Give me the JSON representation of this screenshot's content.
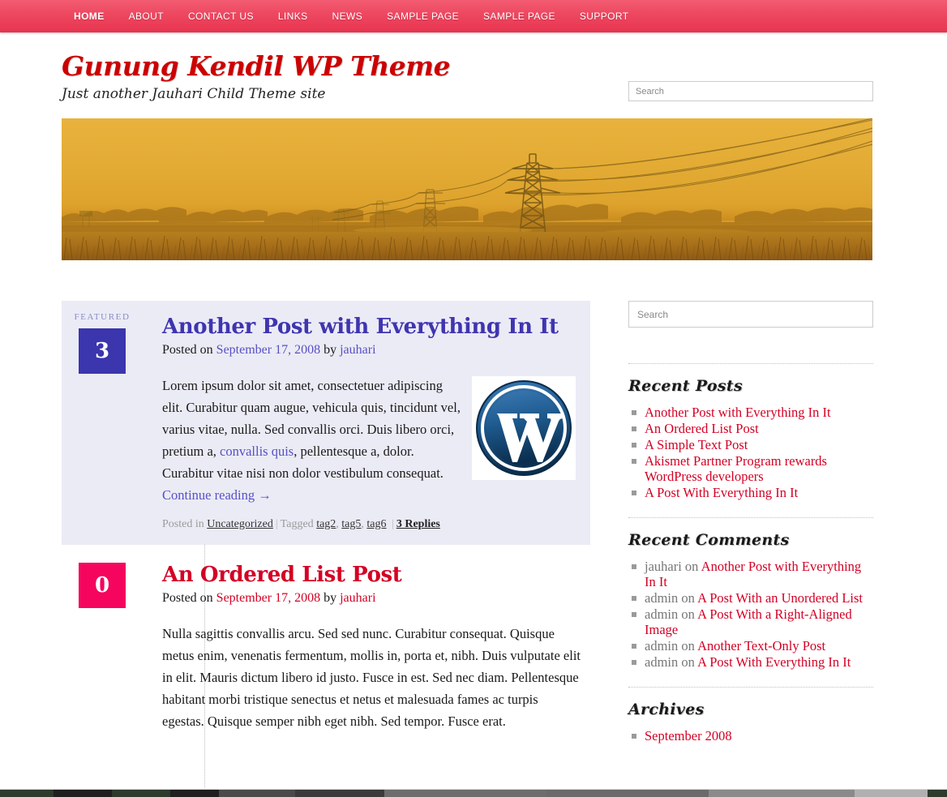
{
  "nav": {
    "items": [
      {
        "label": "HOME",
        "current": true
      },
      {
        "label": "ABOUT",
        "current": false
      },
      {
        "label": "CONTACT US",
        "current": false
      },
      {
        "label": "LINKS",
        "current": false
      },
      {
        "label": "NEWS",
        "current": false
      },
      {
        "label": "SAMPLE PAGE",
        "current": false
      },
      {
        "label": "SAMPLE PAGE",
        "current": false
      },
      {
        "label": "SUPPORT",
        "current": false
      }
    ]
  },
  "header": {
    "site_title": "Gunung Kendil WP Theme",
    "site_description": "Just another Jauhari Child Theme site",
    "search_placeholder": "Search",
    "search_value": "",
    "banner_alt": "sunset-field-powerlines-banner"
  },
  "colors": {
    "nav_red": "#e8344f",
    "title_red": "#cc0000",
    "featured_bg": "#ebebf6",
    "date_blue": "#3b35ae",
    "date_pink": "#f5055e",
    "link_violet": "#5750c4",
    "link_red": "#d40024"
  },
  "posts": [
    {
      "featured": true,
      "featured_label": "FEATURED",
      "comment_count": "3",
      "box_color": "blue",
      "title": "Another Post with Everything In It",
      "title_color": "violet",
      "posted_on_prefix": "Posted on ",
      "date": "September 17, 2008",
      "by_text": " by ",
      "author": "jauhari",
      "body_part_1": "Lorem ipsum dolor sit amet, consectetuer adipiscing elit. Curabitur quam augue, vehicula quis, tincidunt vel, varius vitae, nulla. Sed convallis orci. Duis libero orci, pretium a, ",
      "body_link": "convallis quis",
      "body_part_2": ", pellentesque a, dolor. Curabitur vitae nisi non dolor vestibulum consequat. ",
      "more_link": "Continue reading →",
      "has_image": true,
      "image_name": "wordpress-logo",
      "footer": {
        "posted_in_label": "Posted in ",
        "category": "Uncategorized",
        "tagged_label": "Tagged ",
        "tags": [
          "tag2",
          "tag5",
          "tag6"
        ],
        "replies": "3 Replies"
      }
    },
    {
      "featured": false,
      "featured_label": "",
      "comment_count": "0",
      "box_color": "pink",
      "title": "An Ordered List Post",
      "title_color": "red",
      "posted_on_prefix": "Posted on ",
      "date": "September 17, 2008",
      "by_text": " by ",
      "author": "jauhari",
      "body_part_1": "Nulla sagittis convallis arcu. Sed sed nunc. Curabitur consequat. Quisque metus enim, venenatis fermentum, mollis in, porta et, nibh. Duis vulputate elit in elit. Mauris dictum libero id justo. Fusce in est. Sed nec diam. Pellentesque habitant morbi tristique senectus et netus et malesuada fames ac turpis egestas. Quisque semper nibh eget nibh. Sed tempor. Fusce erat.",
      "body_link": "",
      "body_part_2": "",
      "more_link": "",
      "has_image": false,
      "image_name": "",
      "footer": null
    }
  ],
  "sidebar": {
    "search_placeholder": "Search",
    "search_value": "",
    "widgets": [
      {
        "title": "Recent Posts",
        "type": "links",
        "items": [
          {
            "prefix": "",
            "link": "Another Post with Everything In It"
          },
          {
            "prefix": "",
            "link": "An Ordered List Post"
          },
          {
            "prefix": "",
            "link": "A Simple Text Post"
          },
          {
            "prefix": "",
            "link": "Akismet Partner Program rewards WordPress developers"
          },
          {
            "prefix": "",
            "link": "A Post With Everything In It"
          }
        ]
      },
      {
        "title": "Recent Comments",
        "type": "comments",
        "items": [
          {
            "prefix": "jauhari on ",
            "link": "Another Post with Everything In It"
          },
          {
            "prefix": "admin on ",
            "link": "A Post With an Unordered List"
          },
          {
            "prefix": "admin on ",
            "link": "A Post With a Right-Aligned Image"
          },
          {
            "prefix": "admin on ",
            "link": "Another Text-Only Post"
          },
          {
            "prefix": "admin on ",
            "link": "A Post With Everything In It"
          }
        ]
      },
      {
        "title": "Archives",
        "type": "links",
        "items": [
          {
            "prefix": "",
            "link": "September 2008"
          }
        ]
      }
    ]
  }
}
